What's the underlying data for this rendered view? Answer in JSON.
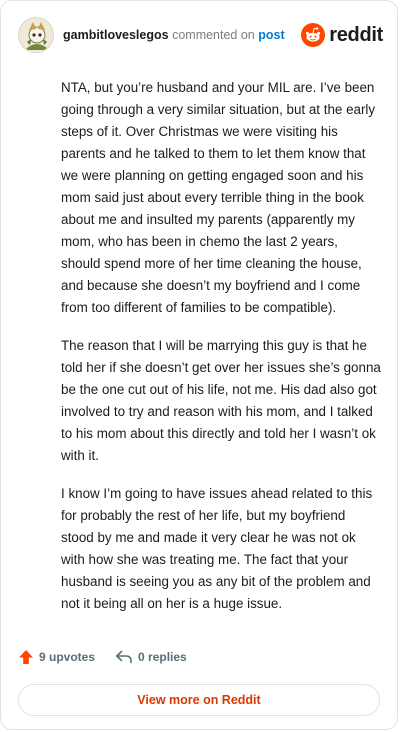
{
  "header": {
    "username": "gambitloveslegos",
    "commented_text": "commented on",
    "post_link": "post",
    "brand_name": "reddit"
  },
  "comment": {
    "paragraphs": [
      "NTA, but you’re husband and your MIL are. I’ve been going through a very similar situation, but at the early steps of it. Over Christmas we were visiting his parents and he talked to them to let them know that we were planning on getting engaged soon and his mom said just about every terrible thing in the book about me and insulted my parents (apparently my mom, who has been in chemo the last 2 years, should spend more of her time cleaning the house, and because she doesn’t my boyfriend and I come from too different of families to be compatible).",
      "The reason that I will be marrying this guy is that he told her if she doesn’t get over her issues she’s gonna be the one cut out of his life, not me. His dad also got involved to try and reason with his mom, and I talked to his mom about this directly and told her I wasn’t ok with it.",
      "I know I’m going to have issues ahead related to this for probably the rest of her life, but my boyfriend stood by me and made it very clear he was not ok with how she was treating me. The fact that your husband is seeing you as any bit of the problem and not it being all on her is a huge issue."
    ]
  },
  "actions": {
    "upvotes_label": "9 upvotes",
    "replies_label": "0 replies"
  },
  "footer": {
    "view_more_label": "View more on Reddit"
  },
  "colors": {
    "brand_orange": "#ff4500",
    "upvote_orange": "#ff4500",
    "link_blue": "#0079d3",
    "view_more_red": "#d93a00"
  },
  "icons": [
    "avatar",
    "reddit-logo-icon",
    "upvote-arrow-icon",
    "reply-icon"
  ]
}
